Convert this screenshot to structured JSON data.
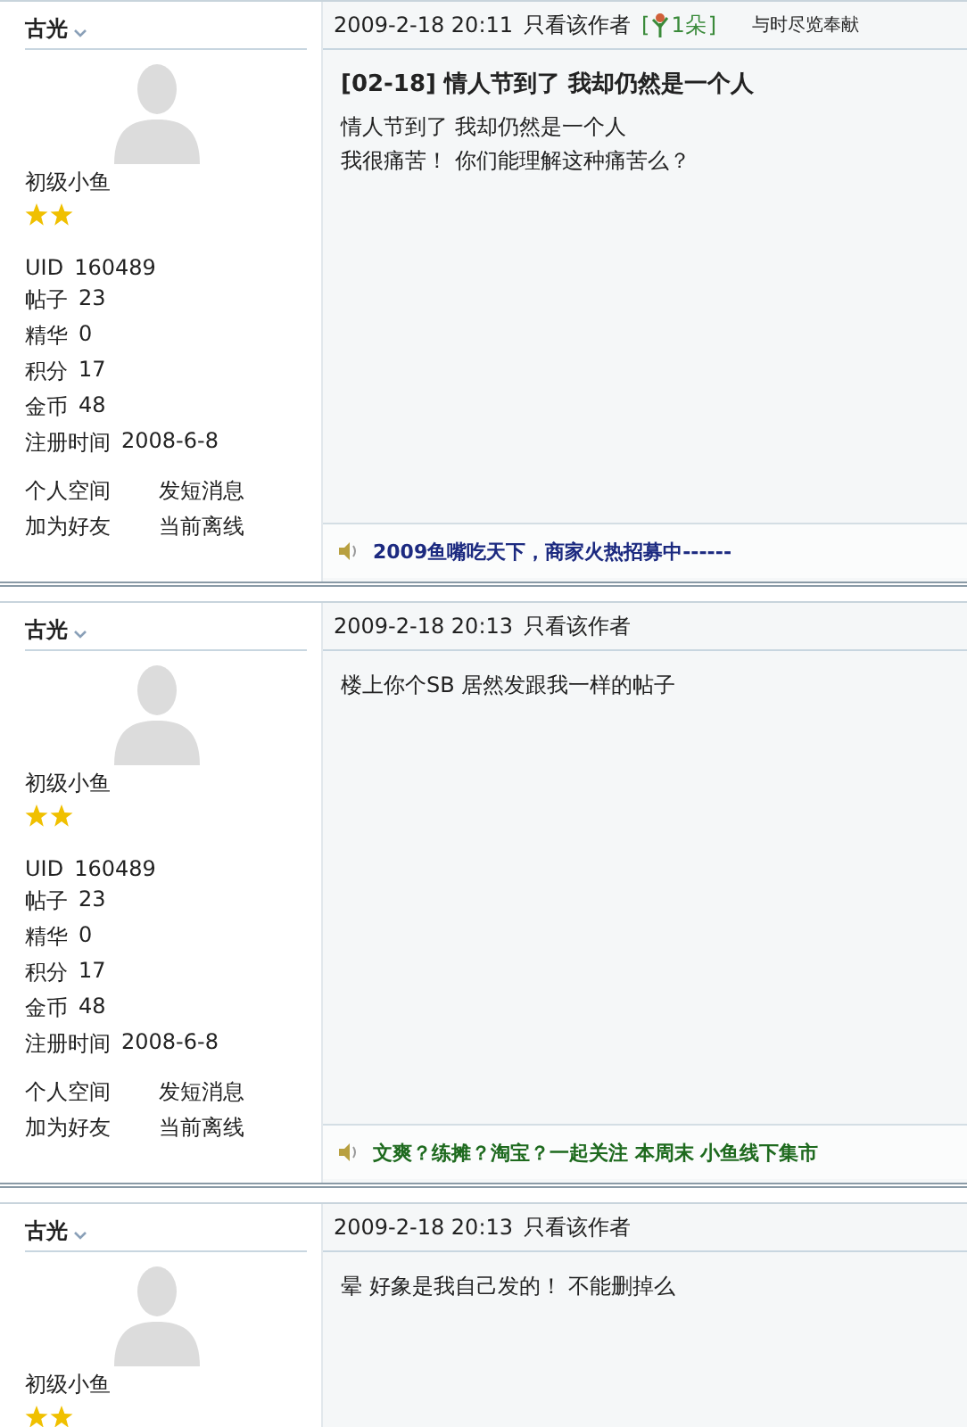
{
  "posts": [
    {
      "author": "古光",
      "time": "2009-2-18 20:11",
      "only_author": "只看该作者",
      "flower": {
        "mark": "[",
        "count": "1朵",
        "close": "]"
      },
      "extra": "与时尽览奉献",
      "rank": "初级小鱼",
      "rank_icons": [
        {
          "kind": "star"
        },
        {
          "kind": "star"
        }
      ],
      "stats": [
        {
          "label": "UID",
          "value": "160489"
        },
        {
          "label": "帖子",
          "value": "23"
        },
        {
          "label": "精华",
          "value": "0"
        },
        {
          "label": "积分",
          "value": "17"
        },
        {
          "label": "金币",
          "value": "48"
        },
        {
          "label": "注册时间",
          "value": "2008-6-8"
        }
      ],
      "links": [
        "个人空间",
        "发短消息",
        "加为好友",
        "当前离线"
      ],
      "title": "[02-18] 情人节到了  我却仍然是一个人",
      "lines": [
        "情人节到了  我却仍然是一个人",
        "我很痛苦！  你们能理解这种痛苦么？"
      ],
      "ad": {
        "text": "2009鱼嘴吃天下，商家火热招募中------",
        "color": "#1c2a80"
      }
    },
    {
      "author": "古光",
      "time": "2009-2-18 20:13",
      "only_author": "只看该作者",
      "rank": "初级小鱼",
      "rank_icons": [
        {
          "kind": "star"
        },
        {
          "kind": "star"
        }
      ],
      "stats": [
        {
          "label": "UID",
          "value": "160489"
        },
        {
          "label": "帖子",
          "value": "23"
        },
        {
          "label": "精华",
          "value": "0"
        },
        {
          "label": "积分",
          "value": "17"
        },
        {
          "label": "金币",
          "value": "48"
        },
        {
          "label": "注册时间",
          "value": "2008-6-8"
        }
      ],
      "links": [
        "个人空间",
        "发短消息",
        "加为好友",
        "当前离线"
      ],
      "lines": [
        "楼上你个SB 居然发跟我一样的帖子"
      ],
      "ad": {
        "text": "文爽？练摊？淘宝？一起关注  本周末  小鱼线下集市",
        "color": "#1e6a1e"
      }
    },
    {
      "author": "古光",
      "time": "2009-2-18 20:13",
      "only_author": "只看该作者",
      "rank": "初级小鱼",
      "rank_icons": [
        {
          "kind": "star"
        },
        {
          "kind": "star"
        }
      ],
      "lines": [
        "晕 好象是我自己发的！  不能删掉么"
      ]
    }
  ]
}
